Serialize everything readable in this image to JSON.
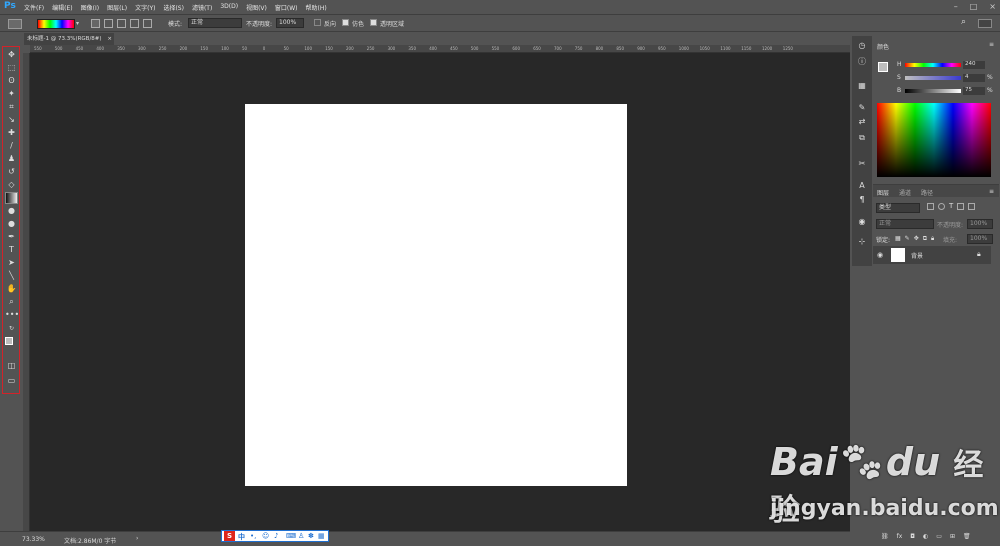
{
  "app": {
    "logo": "Ps"
  },
  "menu": [
    "文件(F)",
    "编辑(E)",
    "图像(I)",
    "图层(L)",
    "文字(Y)",
    "选择(S)",
    "滤镜(T)",
    "3D(D)",
    "视图(V)",
    "窗口(W)",
    "帮助(H)"
  ],
  "options": {
    "mode_label": "模式:",
    "mode_value": "正常",
    "opacity_label": "不透明度:",
    "opacity_value": "100%",
    "reverse_label": "反向",
    "dither_label": "仿色",
    "transparency_label": "透明区域"
  },
  "document": {
    "tab_title": "未标题-1 @ 73.3%(RGB/8#)",
    "close": "×"
  },
  "ruler_ticks": [
    "550",
    "500",
    "450",
    "400",
    "350",
    "300",
    "250",
    "200",
    "150",
    "100",
    "50",
    "0",
    "50",
    "100",
    "150",
    "200",
    "250",
    "300",
    "350",
    "400",
    "450",
    "500",
    "550",
    "600",
    "650",
    "700",
    "750",
    "800",
    "850",
    "900",
    "950",
    "1000",
    "1050",
    "1100",
    "1150",
    "1200",
    "1250"
  ],
  "status": {
    "zoom": "73.33%",
    "doc_info": "文档:2.86M/0 字节"
  },
  "ime": {
    "logo": "S",
    "label": "中"
  },
  "color_panel": {
    "tab": "颜色",
    "h_label": "H",
    "h_value": "240",
    "s_label": "S",
    "s_value": "4",
    "s_unit": "%",
    "b_label": "B",
    "b_value": "75",
    "b_unit": "%"
  },
  "layers_panel": {
    "tabs": [
      "图层",
      "通道",
      "路径"
    ],
    "filter_kind": "类型",
    "blend_mode": "正常",
    "opacity_label": "不透明度:",
    "opacity_value": "100%",
    "lock_label": "锁定:",
    "fill_label": "填充:",
    "fill_value": "100%",
    "layer_name": "背景"
  },
  "watermark": {
    "brand": "Bai",
    "brand2": "du",
    "cn": "经验",
    "url": "jingyan.baidu.com"
  },
  "colors": {
    "accent": "#31a8ff",
    "highlight_box": "#d2232a",
    "bg_dark": "#282828",
    "panel": "#535353"
  }
}
